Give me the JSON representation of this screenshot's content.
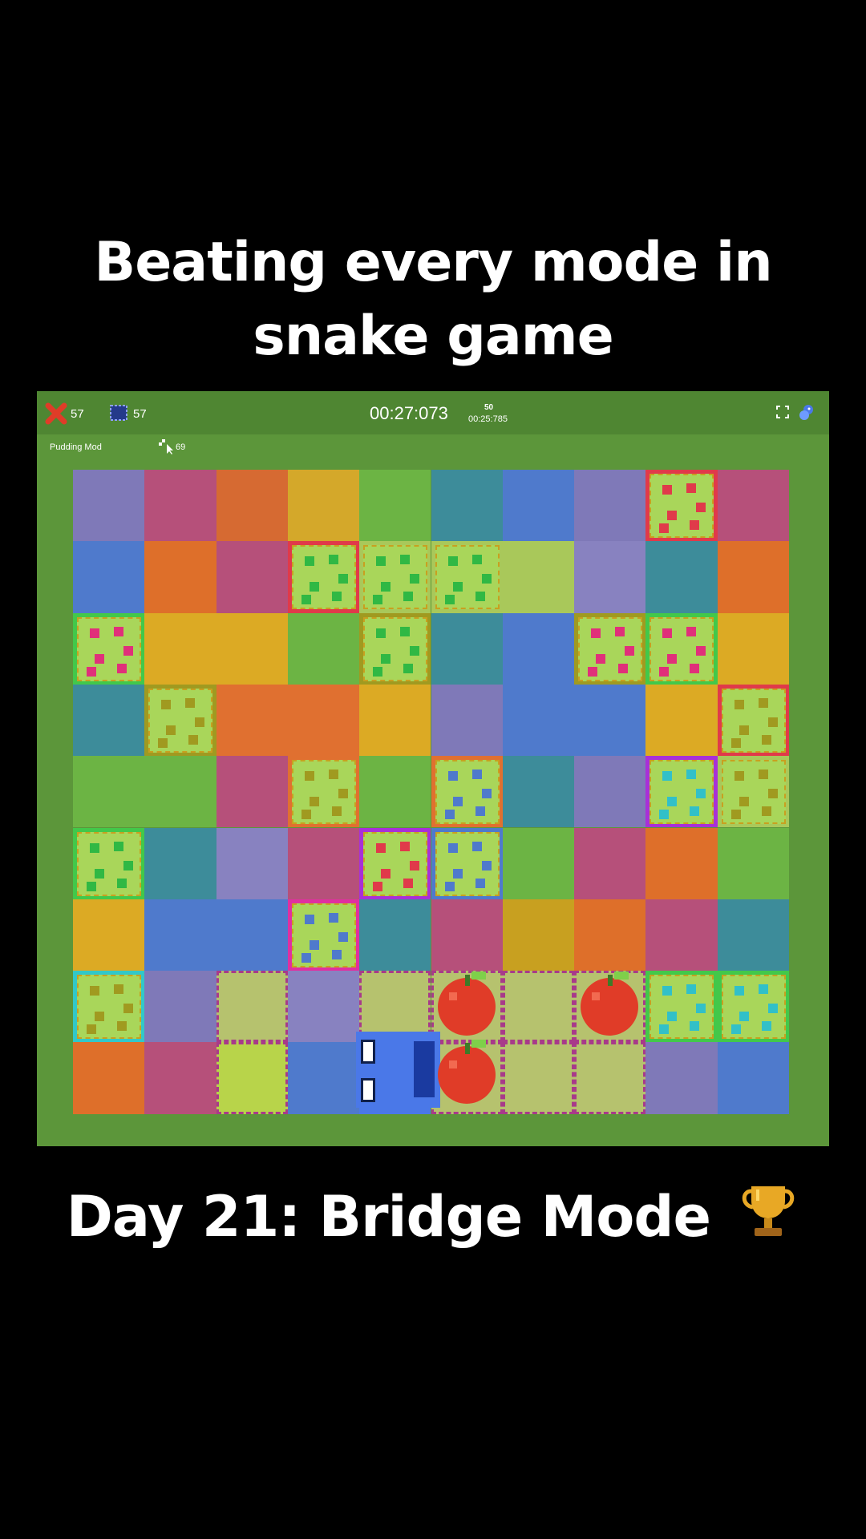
{
  "caption": {
    "title_line1": "Beating every mode in",
    "title_line2": "snake game",
    "subtitle": "Day 21: Bridge Mode",
    "subtitle_icon": "trophy-icon"
  },
  "hud": {
    "apples_icon": "apple-cross-icon",
    "apples_count": "57",
    "board_icon": "board-outline-icon",
    "board_count": "57",
    "timer": "00:27:073",
    "best_count": "50",
    "best_time": "00:25:785",
    "fullscreen_icon": "fullscreen-icon",
    "settings_icon": "snake-settings-icon"
  },
  "subhud": {
    "mode_label": "Pudding Mod",
    "steps_icon": "pointer-icon",
    "steps_count": "69"
  },
  "colors": {
    "background": "#000000",
    "game_bg": "#5c963a",
    "hud_bg": "#4f8632",
    "pudding": "#a9d65a",
    "apple": "#e03c28",
    "snake": "#4a78e8"
  }
}
